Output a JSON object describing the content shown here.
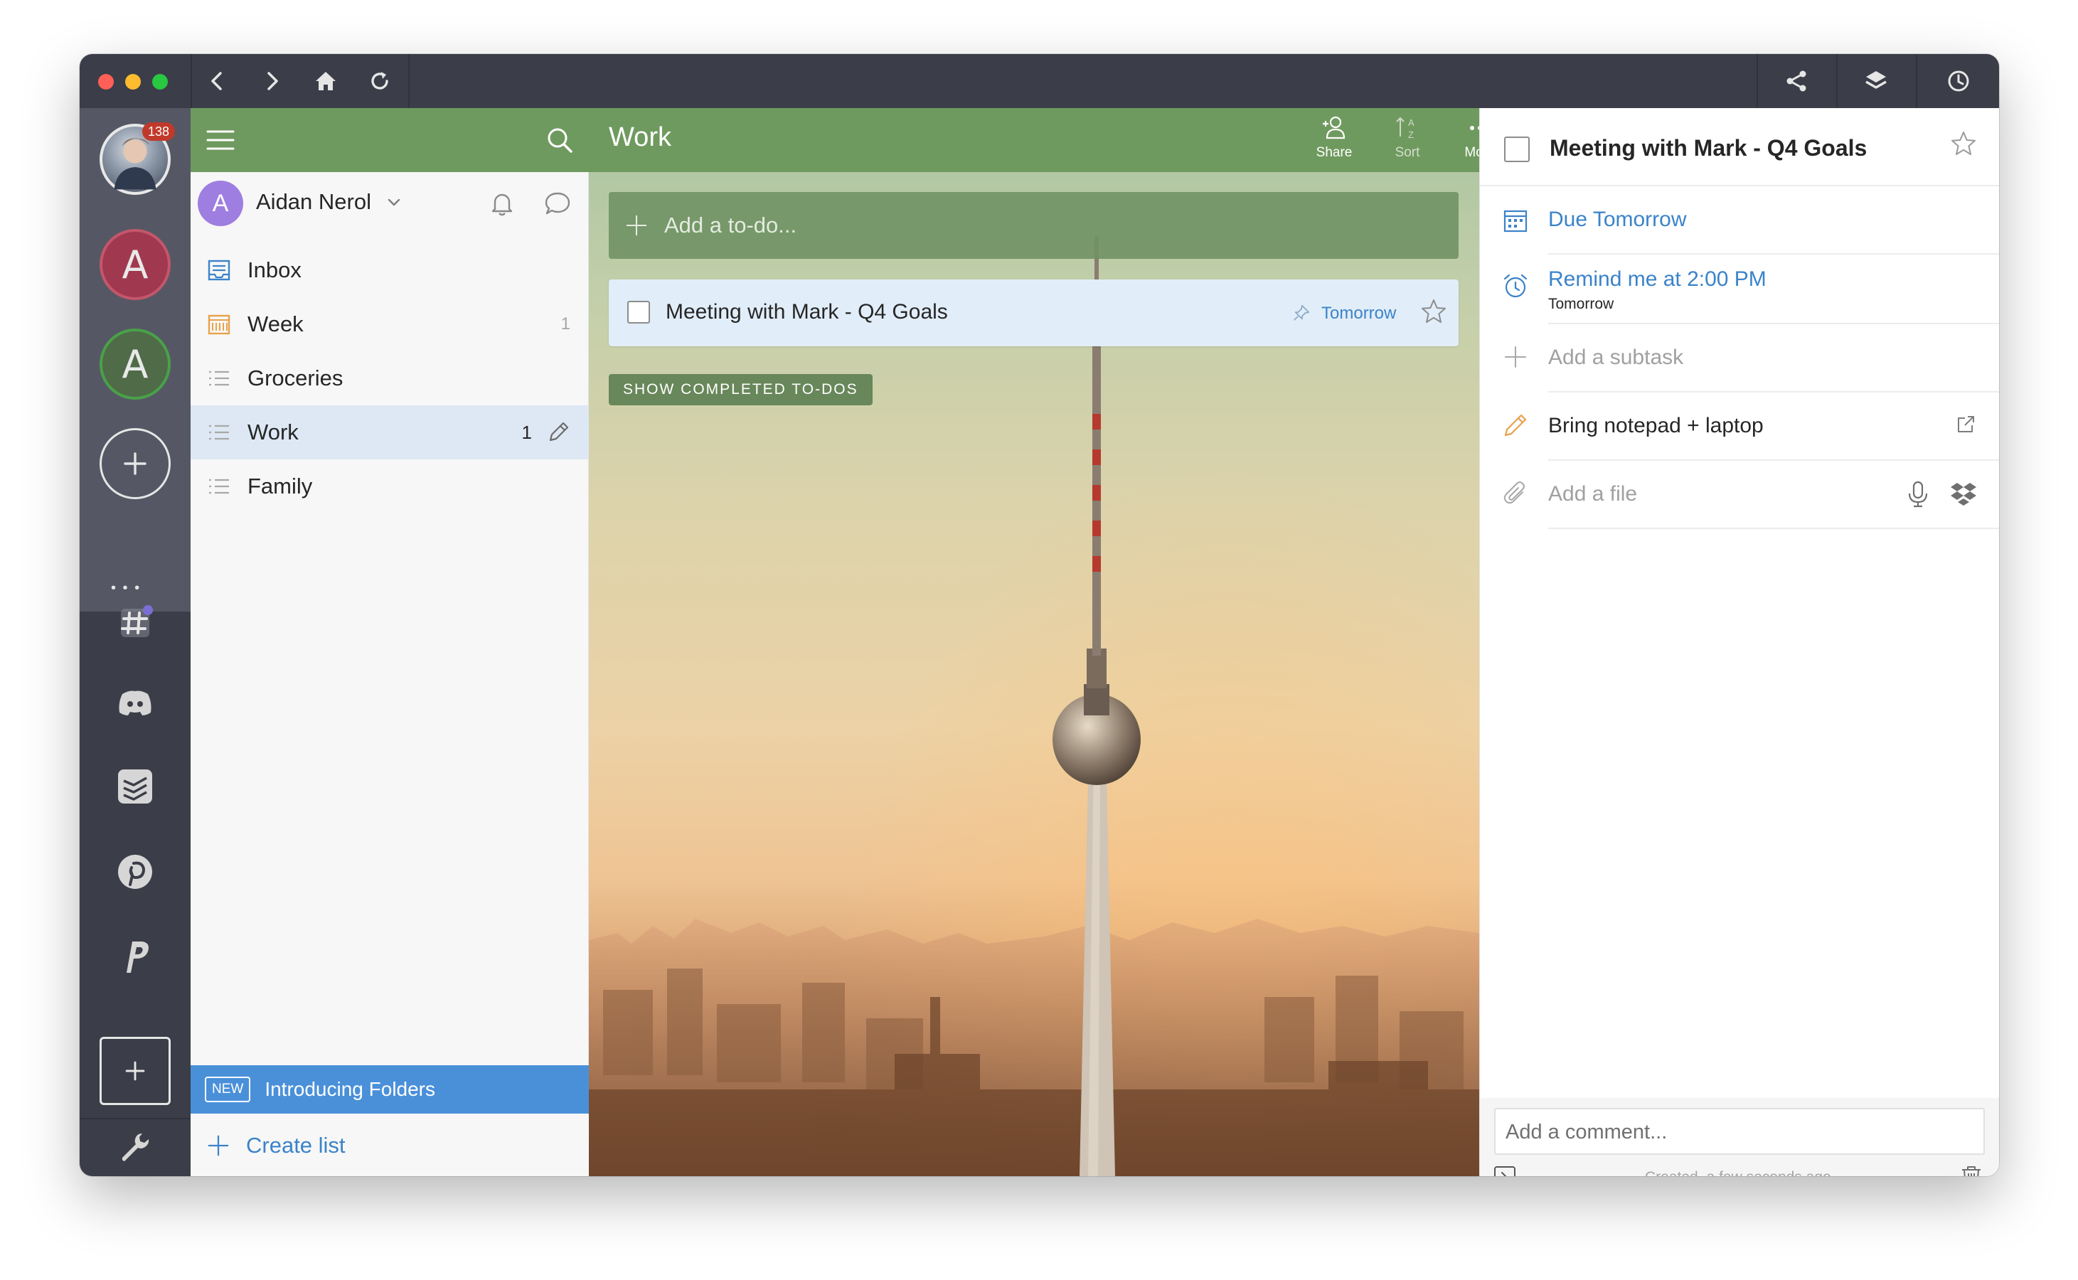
{
  "browser": {
    "traffic_colors": [
      "#fe5f57",
      "#febc2e",
      "#28c840"
    ],
    "icons": [
      "back-icon",
      "forward-icon",
      "home-icon",
      "reload-icon",
      "share-icon",
      "layers-icon",
      "history-icon"
    ]
  },
  "dock": {
    "notification_count": "138",
    "account_initial_1": "A",
    "account_initial_2": "A",
    "overflow": "• • •",
    "apps": [
      "slack-icon",
      "discord-icon",
      "todoist-icon",
      "pinterest-icon",
      "paypal-icon"
    ],
    "colors": {
      "account_1": "#a0394f",
      "account_2": "#4f6b47",
      "badge": "#c0392b"
    }
  },
  "sidebar": {
    "user": {
      "initial": "A",
      "name": "Aidan Nerol",
      "avatar_color": "#9e7ee0"
    },
    "lists": [
      {
        "label": "Inbox",
        "count": "",
        "icon": "inbox-icon"
      },
      {
        "label": "Week",
        "count": "1",
        "icon": "calendar-icon"
      },
      {
        "label": "Groceries",
        "count": "",
        "icon": "list-icon"
      },
      {
        "label": "Work",
        "count": "1",
        "icon": "list-icon"
      },
      {
        "label": "Family",
        "count": "",
        "icon": "list-icon"
      }
    ],
    "promo": {
      "badge": "NEW",
      "label": "Introducing Folders"
    },
    "create_list": "Create list"
  },
  "main": {
    "title": "Work",
    "actions": {
      "share": "Share",
      "sort": "Sort",
      "more": "More"
    },
    "add_placeholder": "Add a to-do...",
    "task": {
      "title": "Meeting with Mark - Q4 Goals",
      "due": "Tomorrow"
    },
    "show_completed": "SHOW COMPLETED TO-DOS",
    "accent": "#6f9a5f"
  },
  "details": {
    "title": "Meeting with Mark - Q4 Goals",
    "due": "Due Tomorrow",
    "reminder": "Remind me at 2:00 PM",
    "reminder_sub": "Tomorrow",
    "add_subtask": "Add a subtask",
    "note": "Bring notepad + laptop",
    "add_file": "Add a file",
    "comment_placeholder": "Add a comment...",
    "created_label": "Created",
    "created_time": "a few seconds ago",
    "link_color": "#3b83c9"
  }
}
